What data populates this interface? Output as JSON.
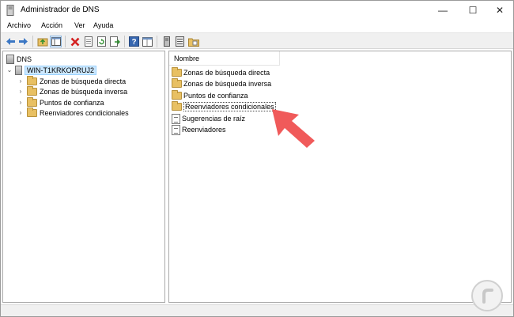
{
  "window": {
    "title": "Administrador de DNS"
  },
  "window_controls": {
    "minimize": "—",
    "maximize": "☐",
    "close": "✕"
  },
  "menu": {
    "items": [
      "Archivo",
      "Acción",
      "Ver",
      "Ayuda"
    ]
  },
  "toolbar": {
    "buttons": [
      "back-icon",
      "forward-icon",
      "up-folder-icon",
      "show-tree-icon",
      "delete-icon",
      "properties-icon",
      "refresh-icon",
      "export-list-icon",
      "help-icon",
      "console-icon",
      "server-icon",
      "records-icon",
      "folder-icon"
    ]
  },
  "tree": {
    "root": "DNS",
    "server": "WIN-T1KRKOPRUJ2",
    "children": [
      "Zonas de búsqueda directa",
      "Zonas de búsqueda inversa",
      "Puntos de confianza",
      "Reenviadores condicionales"
    ]
  },
  "list": {
    "column_header": "Nombre",
    "items": [
      {
        "label": "Zonas de búsqueda directa",
        "icon": "folder-icon"
      },
      {
        "label": "Zonas de búsqueda inversa",
        "icon": "folder-icon"
      },
      {
        "label": "Puntos de confianza",
        "icon": "folder-icon"
      },
      {
        "label": "Reenviadores condicionales",
        "icon": "folder-icon"
      },
      {
        "label": "Sugerencias de raíz",
        "icon": "document-icon"
      },
      {
        "label": "Reenviadores",
        "icon": "document-icon"
      }
    ]
  },
  "annotation": {
    "arrow_color": "#f05a5a"
  }
}
